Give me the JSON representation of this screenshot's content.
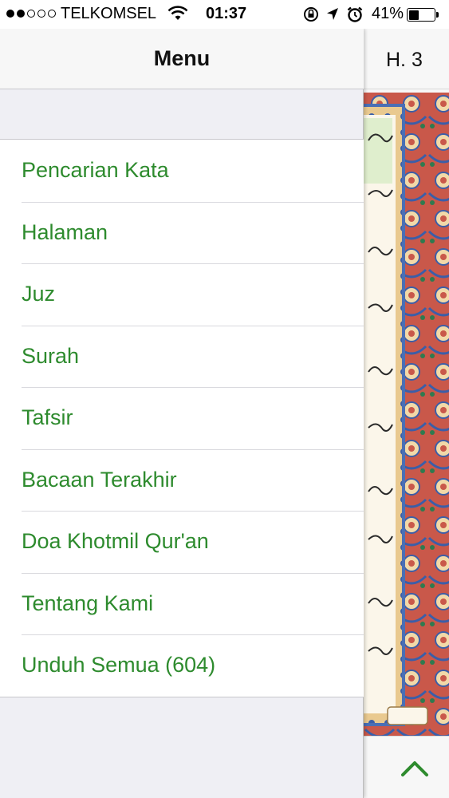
{
  "status_bar": {
    "carrier": "TELKOMSEL",
    "time": "01:37",
    "battery": "41%",
    "battery_level": 0.41,
    "signal_bars_filled": 2,
    "signal_bars_total": 5,
    "icons": [
      "wifi-icon",
      "rotation-lock-icon",
      "location-arrow-icon",
      "alarm-icon",
      "battery-icon"
    ]
  },
  "drawer": {
    "title": "Menu",
    "items": [
      "Pencarian Kata",
      "Halaman",
      "Juz",
      "Surah",
      "Tafsir",
      "Bacaan Terakhir",
      "Doa Khotmil Qur'an",
      "Tentang Kami",
      "Unduh Semua (604)"
    ]
  },
  "reader": {
    "page_indicator": "H. 3"
  },
  "colors": {
    "menu_item_text": "#2e8b2e",
    "nav_background": "#f7f7f7",
    "drawer_background": "#efeff4",
    "up_arrow": "#2e8b2e"
  }
}
